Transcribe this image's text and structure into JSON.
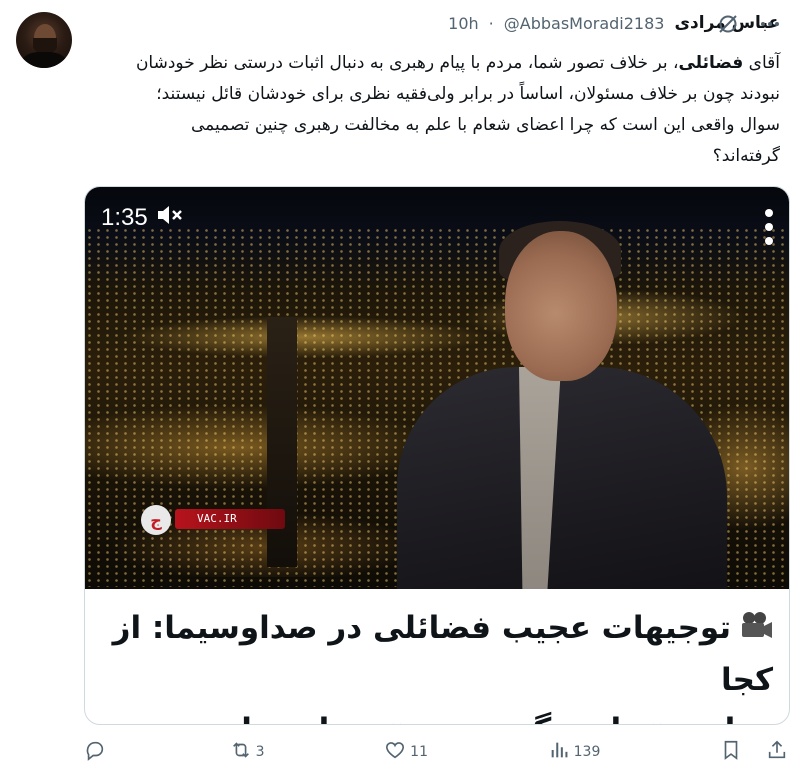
{
  "author": {
    "display_name": "عباس مرادی",
    "handle": "@AbbasMoradi2183",
    "separator": "·",
    "time": "10h"
  },
  "tweet": {
    "bold_name": "فضائلی",
    "line1_start": "آقای",
    "line1_rest": "، بر خلاف تصور شما، مردم با پیام رهبری به دنبال اثبات درستی نظر خودشان",
    "line2": "نبودند چون بر خلاف مسئولان، اساساً در برابر ولی‌فقیه نظری برای خودشان قائل نیستند؛",
    "line3": "سوال واقعی این است که چرا اعضای شعام با علم به مخالفت رهبری چنین تصمیمی",
    "line4": "گرفته‌اند؟"
  },
  "video": {
    "duration": "1:35",
    "channel_logo": "ج",
    "lower_third": "VAC.IR"
  },
  "card": {
    "caption_line1": "توجیهات عجیب فضائلی در صداوسیما: از کجا",
    "caption_line2": "معلوم «نظر دیگر رهبری» همان نظر منتقدان باشد؟"
  },
  "actions": {
    "replies": "",
    "reposts": "3",
    "likes": "11",
    "views": "139"
  },
  "colors": {
    "text": "#0f1419",
    "secondary": "#536471",
    "border": "#cfd9de"
  },
  "icons": [
    "grok-icon",
    "more-icon",
    "mute-icon",
    "video-menu-icon",
    "camera-icon",
    "reply-icon",
    "repost-icon",
    "like-icon",
    "views-icon",
    "bookmark-icon",
    "share-icon"
  ]
}
